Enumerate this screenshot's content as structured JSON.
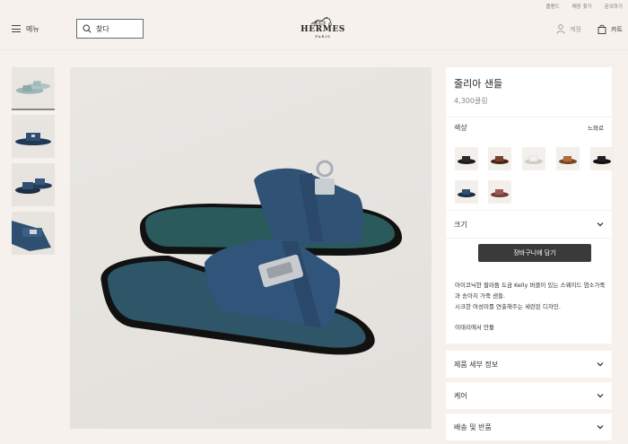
{
  "top_links": [
    "플랜드",
    "매장 찾기",
    "문의하기"
  ],
  "header": {
    "menu_label": "메뉴",
    "search_label": "찾다",
    "logo_brand": "HERMES",
    "logo_city": "PARIS",
    "account_label": "계정",
    "cart_label": "카트"
  },
  "product": {
    "title": "줄리아 샌들",
    "price": "4,300쿨링",
    "color_label": "색상",
    "color_selected": "느와르",
    "size_label": "크기",
    "add_to_cart": "장바구니에 담기",
    "description_line1": "아이코닉한 팔라듐 도금 Kelly 버클이 있는 스웨이드 염소가죽",
    "description_line2": "과 송아지 가죽 샌들.",
    "description_line3": "시크한 여성미를 연출해주는 세련된 디자인.",
    "origin": "이태리에서 만듦"
  },
  "swatches": [
    {
      "name": "black",
      "color": "#2a2a2a"
    },
    {
      "name": "brown",
      "color": "#7b3f2a"
    },
    {
      "name": "white",
      "color": "#e9e6e1"
    },
    {
      "name": "tan",
      "color": "#b06a3b"
    },
    {
      "name": "black-2",
      "color": "#1f1f1f"
    },
    {
      "name": "navy",
      "color": "#2f4f6f"
    },
    {
      "name": "rose",
      "color": "#9a5a52"
    }
  ],
  "accordion": [
    "제품 세부 정보",
    "케어",
    "배송 및 반품"
  ],
  "colors": {
    "background": "#f6f1ec",
    "panel": "#ffffff",
    "button": "#3a3a3a",
    "sandal_navy": "#2f4f70",
    "sandal_sole": "#1a1a1a"
  }
}
